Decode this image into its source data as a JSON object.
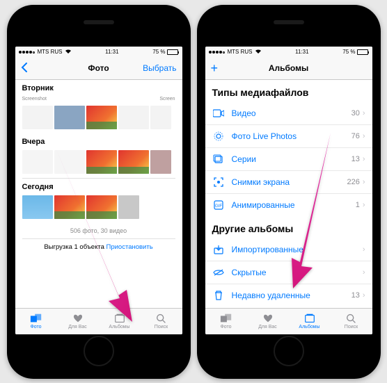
{
  "status": {
    "carrier": "MTS RUS",
    "signal_tech": "",
    "time": "11:31",
    "battery_pct": "75 %"
  },
  "left": {
    "nav_title": "Фото",
    "nav_right": "Выбрать",
    "section_tuesday": "Вторник",
    "section_yesterday": "Вчера",
    "section_today": "Сегодня",
    "summary": "506 фото, 30 видео",
    "upload_prefix": "Выгрузка 1 объекта",
    "upload_action": "Приостановить"
  },
  "right": {
    "nav_title": "Альбомы",
    "section_types": "Типы медиафайлов",
    "section_other": "Другие альбомы",
    "rows_types": [
      {
        "label": "Видео",
        "count": "30"
      },
      {
        "label": "Фото Live Photos",
        "count": "76"
      },
      {
        "label": "Серии",
        "count": "13"
      },
      {
        "label": "Снимки экрана",
        "count": "226"
      },
      {
        "label": "Анимированные",
        "count": "1"
      }
    ],
    "rows_other": [
      {
        "label": "Импортированные",
        "count": ""
      },
      {
        "label": "Скрытые",
        "count": ""
      },
      {
        "label": "Недавно удаленные",
        "count": "13"
      }
    ]
  },
  "tabs": {
    "photos": "Фото",
    "foryou": "Для Вас",
    "albums": "Альбомы",
    "search": "Поиск"
  }
}
